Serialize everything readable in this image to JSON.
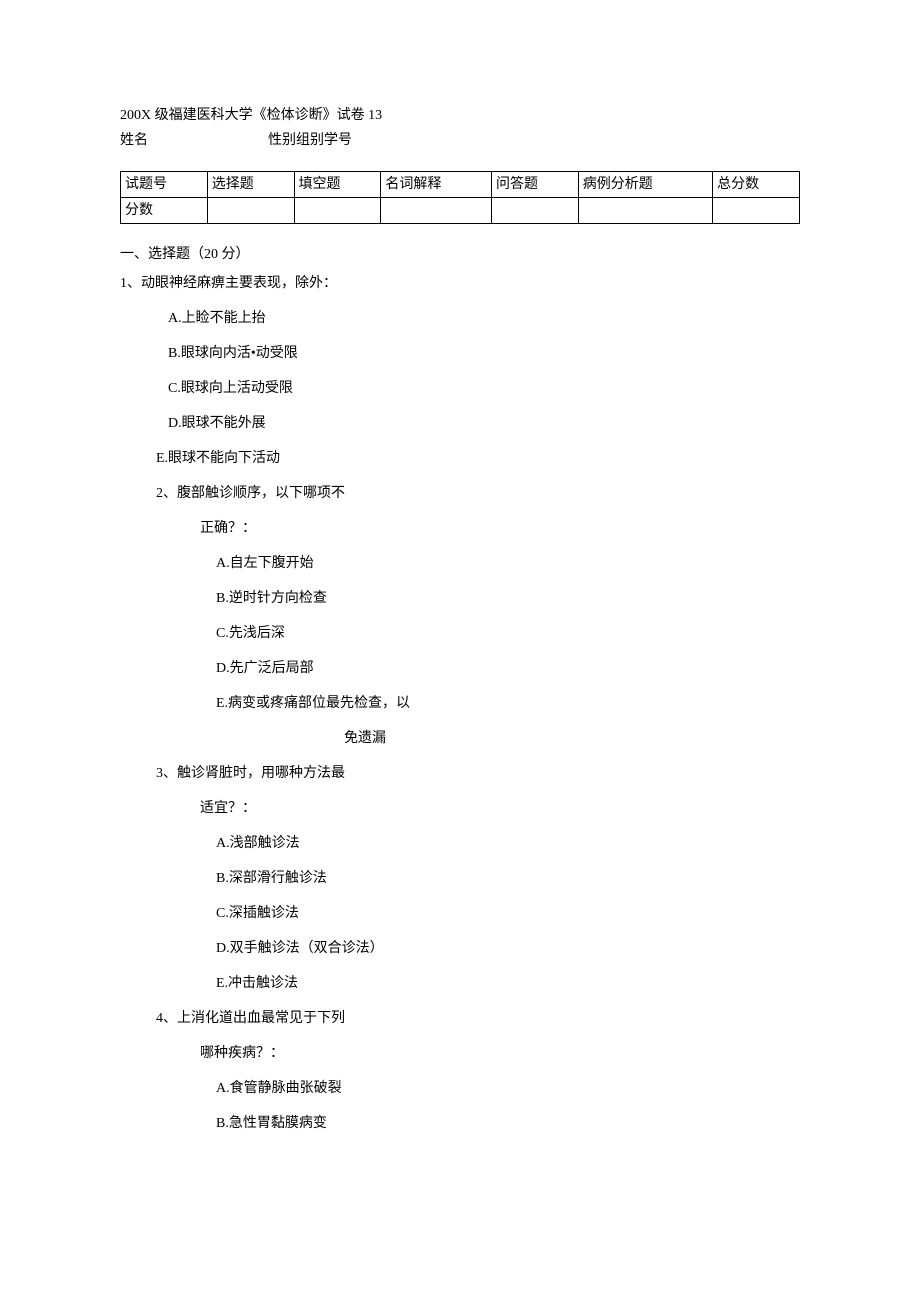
{
  "header": {
    "title": "200X 级福建医科大学《检体诊断》试卷 13",
    "name_label": "姓名",
    "gender_group_id_label": "性别组别学号"
  },
  "table": {
    "row1": [
      "试题号",
      "选择题",
      "填空题",
      "名词解释",
      "问答题",
      "病例分析题",
      "总分数"
    ],
    "row2_label": "分数"
  },
  "section1": {
    "title": "一、选择题（20 分）",
    "q1": {
      "stem": "1、动眼神经麻痹主要表现，除外：",
      "A": "A.上睑不能上抬",
      "B": "B.眼球向内活•动受限",
      "C": "C.眼球向上活动受限",
      "D": "D.眼球不能外展",
      "E": "E.眼球不能向下活动"
    },
    "q2": {
      "stem": "2、腹部触诊顺序，以下哪项不",
      "stem2": "正确？：",
      "A": "A.自左下腹开始",
      "B": "B.逆时针方向检查",
      "C": "C.先浅后深",
      "D": "D.先广泛后局部",
      "E": "E.病变或疼痛部位最先检查，以",
      "E2": "免遗漏"
    },
    "q3": {
      "stem": "3、触诊肾脏时，用哪种方法最",
      "stem2": "适宜？：",
      "A": "A.浅部触诊法",
      "B": "B.深部滑行触诊法",
      "C": "C.深插触诊法",
      "D": "D.双手触诊法（双合诊法）",
      "E": "E.冲击触诊法"
    },
    "q4": {
      "stem": "4、上消化道出血最常见于下列",
      "stem2": "哪种疾病？：",
      "A": "A.食管静脉曲张破裂",
      "B": "B.急性胃黏膜病变"
    }
  }
}
